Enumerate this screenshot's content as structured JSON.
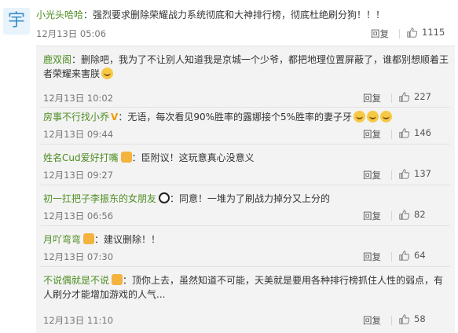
{
  "comment": {
    "avatar_glyph": "宇",
    "username": "小光头哈哈",
    "colon": "：",
    "text": "强烈要求删除荣耀战力系统彻底和大神排行榜，彻底杜绝刷分狗！！！",
    "time": "12月13日 05:06",
    "reply_label": "回复",
    "likes": "1115"
  },
  "replies": [
    {
      "username": "鹿双阁",
      "colon": "：",
      "text": "删除吧，我为了不让别人知道我是京城一个少爷，都把地理位置屏蔽了，谁都别想顺着王者荣耀来害朕",
      "time": "12月13日 10:02",
      "reply_label": "回复",
      "likes": "227",
      "icon": "emoji-icon"
    },
    {
      "username": "房事不行找小乔",
      "colon": "：",
      "text": "无语，每次看见90%胜率的露娜接个5%胜率的妻子牙",
      "time": "12月13日 09:44",
      "reply_label": "回复",
      "likes": "146",
      "icon": "vip-v-icon",
      "vip_mark": "V"
    },
    {
      "username": "姓名Cud爱好打嘴",
      "colon": "：",
      "text": "臣附议！这玩意真心没意义",
      "time": "12月13日 09:27",
      "reply_label": "回复",
      "likes": "137",
      "icon": "badge-icon"
    },
    {
      "username": "初一扛把子李振东的女朋友",
      "colon": "：",
      "text": "同意！一堆为了刷战力掉分又上分的",
      "time": "12月13日 06:56",
      "reply_label": "回复",
      "likes": "82",
      "icon": "panda-icon"
    },
    {
      "username": "月吖弯弯",
      "colon": "：",
      "text": "建议删除！！",
      "time": "12月13日 07:30",
      "reply_label": "回复",
      "likes": "64",
      "icon": "badge-icon"
    },
    {
      "username": "不说偶就是不说",
      "colon": "：",
      "text": "顶你上去，虽然知道不可能，天美就是要用各种排行榜抓住人性的弱点，有人刷分才能增加游戏的人气...",
      "time": "12月13日 11:10",
      "reply_label": "回复",
      "likes": "58",
      "icon": "badge-icon"
    }
  ],
  "colors": {
    "username": "#4e8d23",
    "panel_bg": "#f3f3f3",
    "vip": "#f29a00"
  }
}
